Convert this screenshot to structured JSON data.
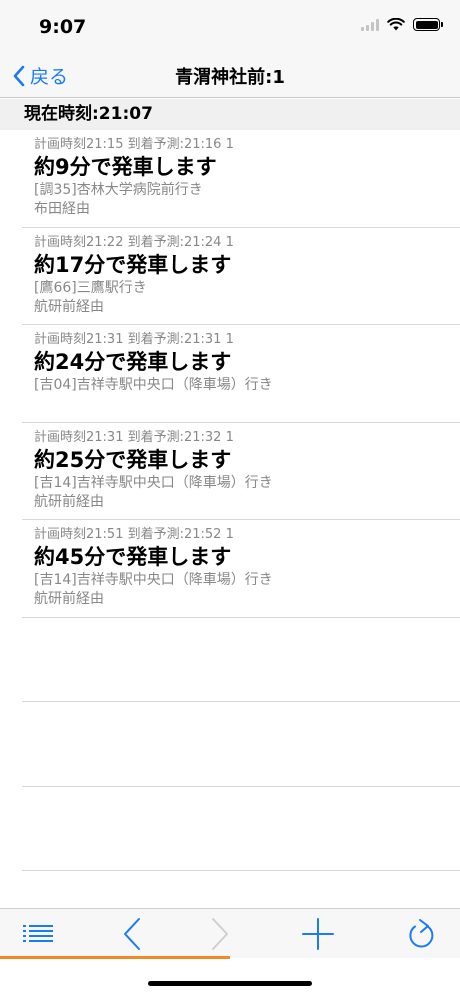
{
  "status": {
    "time": "9:07"
  },
  "nav": {
    "back_label": "戻る",
    "title": "青渭神社前:1"
  },
  "current_time": "現在時刻:21:07",
  "departures": [
    {
      "plan": "計画時刻21:15 到着予測:21:16 1",
      "eta": "約9分で発車します",
      "route": "[調35]杏林大学病院前行き",
      "via": "布田経由"
    },
    {
      "plan": "計画時刻21:22 到着予測:21:24 1",
      "eta": "約17分で発車します",
      "route": "[鷹66]三鷹駅行き",
      "via": "航研前経由"
    },
    {
      "plan": "計画時刻21:31 到着予測:21:31 1",
      "eta": "約24分で発車します",
      "route": "[吉04]吉祥寺駅中央口（降車場）行き",
      "via": ""
    },
    {
      "plan": "計画時刻21:31 到着予測:21:32 1",
      "eta": "約25分で発車します",
      "route": "[吉14]吉祥寺駅中央口（降車場）行き",
      "via": "航研前経由"
    },
    {
      "plan": "計画時刻21:51 到着予測:21:52 1",
      "eta": "約45分で発車します",
      "route": "[吉14]吉祥寺駅中央口（降車場）行き",
      "via": "航研前経由"
    }
  ],
  "toolbar": {
    "icons": [
      "list-icon",
      "back-arrow-icon",
      "forward-arrow-icon",
      "plus-icon",
      "refresh-icon"
    ]
  },
  "page_load_progress": 0.5,
  "colors": {
    "accent": "#1a7cf5",
    "progress": "#f08a24",
    "secondary_text": "#888888"
  }
}
